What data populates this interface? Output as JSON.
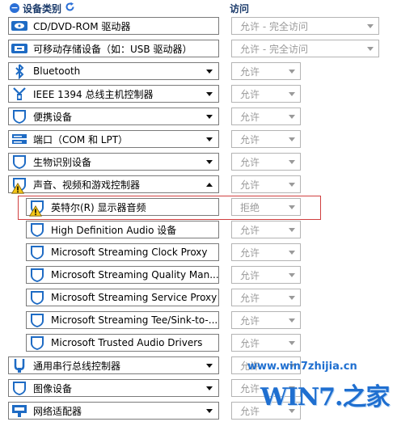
{
  "header": {
    "category_label": "设备类别",
    "access_label": "访问"
  },
  "devices": [
    {
      "label": "CD/DVD-ROM 驱动器",
      "icon": "disc-icon",
      "access": "允许 - 完全访问",
      "indent": 0,
      "has_arrow": false,
      "warning": false
    },
    {
      "label": "可移动存储设备（如：USB 驱动器）",
      "icon": "usb-drive-icon",
      "access": "允许 - 完全访问",
      "indent": 0,
      "has_arrow": false,
      "warning": false
    },
    {
      "label": "Bluetooth",
      "icon": "bluetooth-icon",
      "access": "允许",
      "indent": 0,
      "has_arrow": true,
      "warning": false
    },
    {
      "label": "IEEE 1394 总线主机控制器",
      "icon": "firewire-icon",
      "access": "允许",
      "indent": 0,
      "has_arrow": true,
      "warning": false
    },
    {
      "label": "便携设备",
      "icon": "shield-icon",
      "access": "允许",
      "indent": 0,
      "has_arrow": true,
      "warning": false
    },
    {
      "label": "端口（COM 和 LPT）",
      "icon": "port-icon",
      "access": "允许",
      "indent": 0,
      "has_arrow": true,
      "warning": false
    },
    {
      "label": "生物识别设备",
      "icon": "shield-icon",
      "access": "允许",
      "indent": 0,
      "has_arrow": true,
      "warning": false
    },
    {
      "label": "声音、视频和游戏控制器",
      "icon": "shield-icon",
      "access": "允许",
      "indent": 0,
      "has_arrow": true,
      "arrow_up": true,
      "warning": true
    },
    {
      "label": "英特尔(R) 显示器音频",
      "icon": "shield-icon",
      "access": "拒绝",
      "indent": 1,
      "has_arrow": false,
      "warning": true
    },
    {
      "label": "High Definition Audio 设备",
      "icon": "shield-icon",
      "access": "允许",
      "indent": 1,
      "has_arrow": false,
      "warning": false
    },
    {
      "label": "Microsoft Streaming Clock Proxy",
      "icon": "shield-icon",
      "access": "允许",
      "indent": 1,
      "has_arrow": false,
      "warning": false
    },
    {
      "label": "Microsoft Streaming Quality Man...",
      "icon": "shield-icon",
      "access": "允许",
      "indent": 1,
      "has_arrow": false,
      "warning": false
    },
    {
      "label": "Microsoft Streaming Service Proxy",
      "icon": "shield-icon",
      "access": "允许",
      "indent": 1,
      "has_arrow": false,
      "warning": false
    },
    {
      "label": "Microsoft Streaming Tee/Sink-to-...",
      "icon": "shield-icon",
      "access": "允许",
      "indent": 1,
      "has_arrow": false,
      "warning": false
    },
    {
      "label": "Microsoft Trusted Audio Drivers",
      "icon": "shield-icon",
      "access": "允许",
      "indent": 1,
      "has_arrow": false,
      "warning": false
    },
    {
      "label": "通用串行总线控制器",
      "icon": "usb-icon",
      "access": "允许",
      "indent": 0,
      "has_arrow": true,
      "warning": false
    },
    {
      "label": "图像设备",
      "icon": "shield-icon",
      "access": "允许",
      "indent": 0,
      "has_arrow": true,
      "warning": false
    },
    {
      "label": "网络适配器",
      "icon": "network-icon",
      "access": "允许",
      "indent": 0,
      "has_arrow": true,
      "warning": false
    }
  ],
  "watermark": {
    "url": "www.win7zhijia.cn",
    "logo_text": "WIN7.之家"
  },
  "colors": {
    "accent": "#2a6fd6",
    "highlight": "#d04040",
    "icon_blue": "#1e6bc4"
  }
}
